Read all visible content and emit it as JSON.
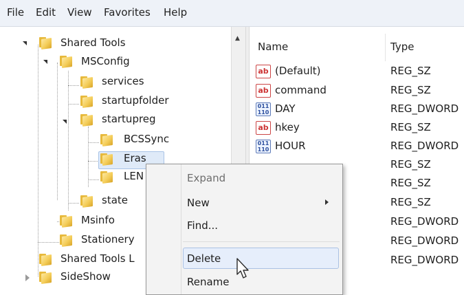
{
  "menubar": {
    "items": [
      "File",
      "Edit",
      "View",
      "Favorites",
      "Help"
    ]
  },
  "tree": {
    "items": [
      {
        "label": "Shared Tools"
      },
      {
        "label": "MSConfig"
      },
      {
        "label": "services"
      },
      {
        "label": "startupfolder"
      },
      {
        "label": "startupreg"
      },
      {
        "label": "BCSSync"
      },
      {
        "label": "Eras"
      },
      {
        "label": "LEN"
      },
      {
        "label": "state"
      },
      {
        "label": "Msinfo"
      },
      {
        "label": "Stationery"
      },
      {
        "label": "Shared Tools L"
      },
      {
        "label": "SideShow"
      }
    ]
  },
  "list": {
    "columns": [
      "Name",
      "Type"
    ],
    "rows": [
      {
        "icon": "ab-string-icon",
        "name": "(Default)",
        "type": "REG_SZ"
      },
      {
        "icon": "ab-string-icon",
        "name": "command",
        "type": "REG_SZ"
      },
      {
        "icon": "dword-icon",
        "name": "DAY",
        "type": "REG_DWORD"
      },
      {
        "icon": "ab-string-icon",
        "name": "hkey",
        "type": "REG_SZ"
      },
      {
        "icon": "dword-icon",
        "name": "HOUR",
        "type": "REG_DWORD"
      },
      {
        "icon": "",
        "name": "",
        "type": "REG_SZ"
      },
      {
        "icon": "",
        "name": "",
        "type": "REG_SZ"
      },
      {
        "icon": "",
        "name": "",
        "type": "REG_SZ"
      },
      {
        "icon": "",
        "name": "",
        "type": "REG_DWORD"
      },
      {
        "icon": "",
        "name": "",
        "type": "REG_DWORD"
      },
      {
        "icon": "",
        "name": "",
        "type": "REG_DWORD"
      }
    ]
  },
  "context_menu": {
    "expand": "Expand",
    "new": "New",
    "find": "Find...",
    "delete": "Delete",
    "rename": "Rename"
  },
  "icon_glyphs": {
    "string": "ab",
    "dword": "011\n110"
  },
  "colors": {
    "highlight": "#e6eefb",
    "selection": "#dfeaf8",
    "folder": "#f4cd59"
  }
}
